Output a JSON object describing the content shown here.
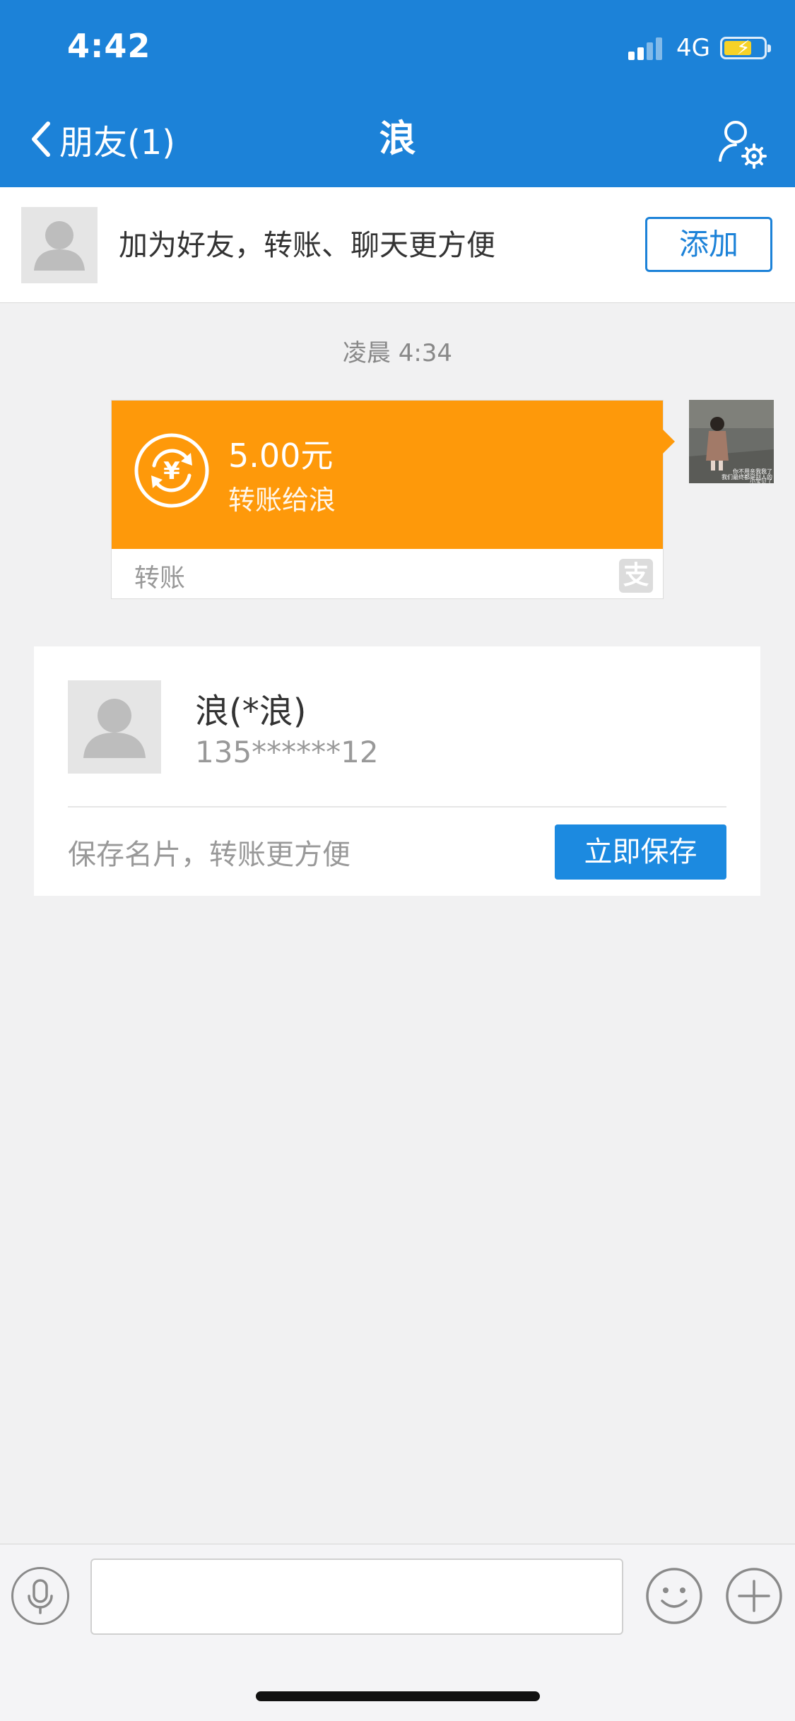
{
  "status_bar": {
    "time": "4:42",
    "network": "4G",
    "battery_icon": "battery-charging-icon",
    "signal_icon": "signal-icon"
  },
  "nav": {
    "back_label": "朋友(1)",
    "title": "浪",
    "settings_icon": "user-settings-icon"
  },
  "banner": {
    "text": "加为好友，转账、聊天更方便",
    "add_label": "添加"
  },
  "chat": {
    "timestamp": "凌晨 4:34",
    "transfer": {
      "amount": "5.00元",
      "description": "转账给浪",
      "footer": "转账",
      "brand_glyph": "支"
    },
    "sender_avatar_caption": [
      "你不用亲我我了",
      "我们最终都是别人的",
      "小宝贝了"
    ]
  },
  "contact_card": {
    "name": "浪(*浪)",
    "phone": "135******12",
    "hint": "保存名片，转账更方便",
    "save_label": "立即保存"
  },
  "input_bar": {
    "placeholder": "",
    "icons": [
      "microphone-icon",
      "emoji-icon",
      "plus-icon"
    ]
  },
  "colors": {
    "primary": "#1c82d8",
    "transfer_orange": "#fe990a",
    "background": "#f1f1f2"
  }
}
